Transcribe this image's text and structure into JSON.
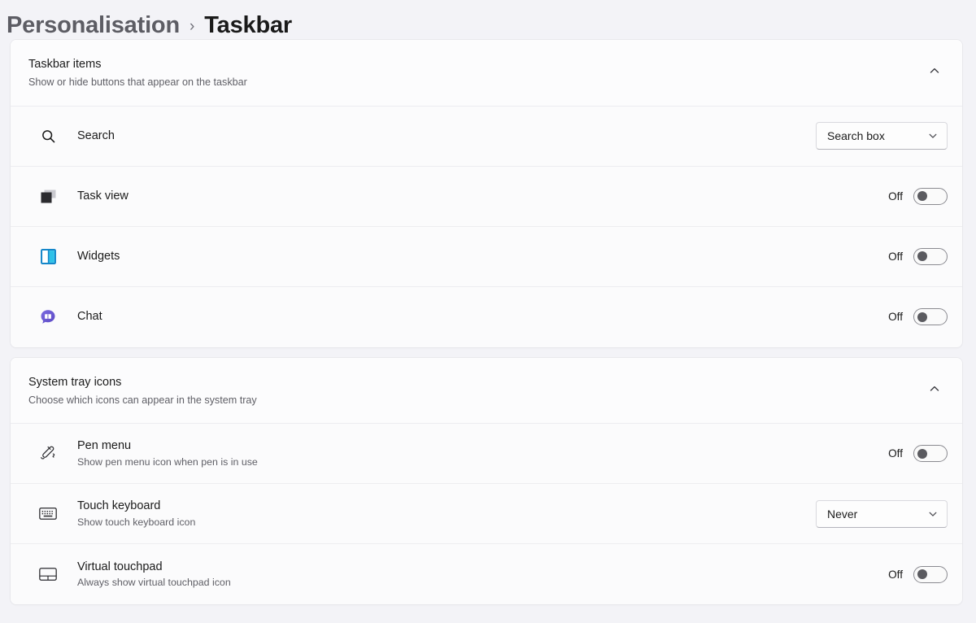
{
  "breadcrumb": {
    "parent": "Personalisation",
    "separator": "›",
    "current": "Taskbar"
  },
  "sections": [
    {
      "id": "taskbar-items",
      "title": "Taskbar items",
      "subtitle": "Show or hide buttons that appear on the taskbar",
      "expanded_icon": "chevron-up-icon",
      "rows": [
        {
          "id": "search",
          "icon": "search-icon",
          "label": "Search",
          "sub": "",
          "control": "dropdown",
          "value": "Search box",
          "chevron": "chevron-down-icon"
        },
        {
          "id": "task-view",
          "icon": "task-view-icon",
          "label": "Task view",
          "sub": "",
          "control": "toggle",
          "state": "Off"
        },
        {
          "id": "widgets",
          "icon": "widgets-icon",
          "label": "Widgets",
          "sub": "",
          "control": "toggle",
          "state": "Off"
        },
        {
          "id": "chat",
          "icon": "chat-icon",
          "label": "Chat",
          "sub": "",
          "control": "toggle",
          "state": "Off"
        }
      ]
    },
    {
      "id": "system-tray-icons",
      "title": "System tray icons",
      "subtitle": "Choose which icons can appear in the system tray",
      "expanded_icon": "chevron-up-icon",
      "rows": [
        {
          "id": "pen-menu",
          "icon": "pen-icon",
          "label": "Pen menu",
          "sub": "Show pen menu icon when pen is in use",
          "control": "toggle",
          "state": "Off"
        },
        {
          "id": "touch-keyboard",
          "icon": "keyboard-icon",
          "label": "Touch keyboard",
          "sub": "Show touch keyboard icon",
          "control": "dropdown",
          "value": "Never",
          "chevron": "chevron-down-icon"
        },
        {
          "id": "virtual-touchpad",
          "icon": "touchpad-icon",
          "label": "Virtual touchpad",
          "sub": "Always show virtual touchpad icon",
          "control": "toggle",
          "state": "Off"
        }
      ]
    }
  ],
  "colors": {
    "page_background": "#f3f3f7",
    "card_background": "#fbfbfc",
    "widgets_accent": "#28b5e1",
    "chat_accent": "#6b5bd2",
    "text_primary": "#1b1b1b",
    "text_secondary": "#5f5f66"
  }
}
